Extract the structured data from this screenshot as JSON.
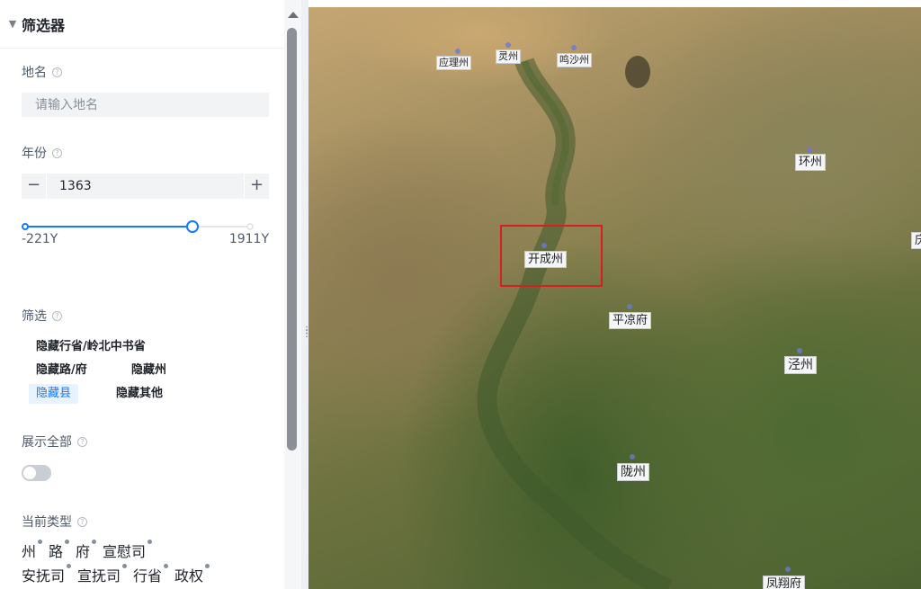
{
  "panel": {
    "title": "筛选器",
    "place_search": {
      "label": "地名",
      "placeholder": "请输入地名",
      "value": ""
    },
    "year": {
      "label": "年份",
      "value": "1363",
      "minus": "−",
      "plus": "+"
    },
    "year_slider": {
      "min_label": "-221Y",
      "max_label": "1911Y",
      "min": -221,
      "max": 1911,
      "value": 1363
    },
    "filter": {
      "label": "筛选",
      "items": [
        {
          "label": "隐藏行省/岭北中书省",
          "active": false
        },
        {
          "label": "隐藏路/府",
          "active": false
        },
        {
          "label": "隐藏州",
          "active": false
        },
        {
          "label": "隐藏县",
          "active": true
        },
        {
          "label": "隐藏其他",
          "active": false
        }
      ]
    },
    "show_all": {
      "label": "展示全部",
      "enabled": false
    },
    "current_types": {
      "label": "当前类型",
      "row1": [
        "州",
        "路",
        "府",
        "宣慰司"
      ],
      "row2": [
        "安抚司",
        "宣抚司",
        "行省",
        "政权"
      ]
    }
  },
  "map": {
    "places": [
      {
        "name": "应理州"
      },
      {
        "name": "灵州"
      },
      {
        "name": "鸣沙州"
      },
      {
        "name": "环州"
      },
      {
        "name": "开成州"
      },
      {
        "name": "平凉府"
      },
      {
        "name": "泾州"
      },
      {
        "name": "陇州"
      },
      {
        "name": "凤翔府"
      },
      {
        "name": "庆"
      }
    ],
    "highlight_color": "#d81e1e"
  },
  "colors": {
    "accent": "#1677ff",
    "toggle_off": "#c9cdd4"
  }
}
